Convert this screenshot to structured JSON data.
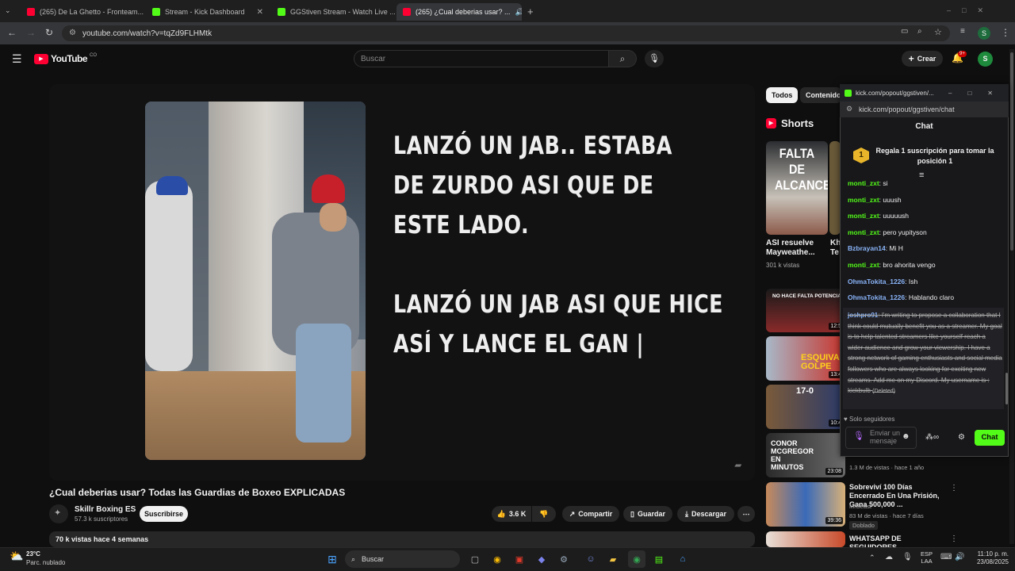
{
  "browser": {
    "tabs": [
      {
        "title": "(265) De La Ghetto - Fronteam...",
        "color": "#ff0033"
      },
      {
        "title": "Stream - Kick Dashboard",
        "color": "#53fc18"
      },
      {
        "title": "GGStiven Stream - Watch Live ...",
        "color": "#53fc18"
      },
      {
        "title": "(265) ¿Cual deberias usar? ...",
        "color": "#ff0033"
      }
    ],
    "url": "youtube.com/watch?v=tqZd9FLHMtk",
    "profile": "S"
  },
  "youtube": {
    "logo": "YouTube",
    "region": "CO",
    "search_placeholder": "Buscar",
    "create_label": "Crear",
    "notif_count": "9+",
    "avatar": "S"
  },
  "video": {
    "captions": [
      "LANZÓ UN JAB.. ESTABA",
      "DE ZURDO ASI QUE DE",
      "ESTE LADO.",
      "LANZÓ UN JAB ASI QUE HICE",
      "ASÍ Y LANCE EL GAN |"
    ],
    "title": "¿Cual deberias usar? Todas las Guardias de Boxeo EXPLICADAS",
    "channel": "Skillr Boxing ES",
    "subscribers": "57.3 k suscriptores",
    "subscribe_label": "Suscribirse",
    "likes": "3.6 K",
    "share_label": "Compartir",
    "save_label": "Guardar",
    "download_label": "Descargar",
    "description_stats": "70 k vistas  hace 4 semanas"
  },
  "sidebar": {
    "chips": [
      "Todos",
      "Contenido d"
    ],
    "shorts_heading": "Shorts",
    "shorts": [
      {
        "thumb_text": "FALTA DE ALCANCE",
        "title": "ASI resuelve Mayweathe...",
        "meta": "301 k vistas"
      },
      {
        "thumb_text": "",
        "title": "Kh Te",
        "meta": ""
      }
    ],
    "related": [
      {
        "thumb_text": "NO HACE FALTA POTENCIA",
        "dur": "12:5",
        "title": "",
        "channel": "",
        "meta": ""
      },
      {
        "thumb_text": "ESQUIVA GOLPE",
        "dur": "13:4",
        "title": "",
        "channel": "",
        "meta": ""
      },
      {
        "thumb_text": "17-0",
        "dur": "10:4",
        "title": "",
        "channel": "",
        "meta": ""
      },
      {
        "thumb_text": "CONOR MCGREGOR EN MINUTOS",
        "dur": "23:08",
        "title": "",
        "channel": "",
        "meta": "1.3 M de vistas · hace 1 año"
      },
      {
        "thumb_text": "",
        "dur": "39:36",
        "title": "Sobreviví 100 Días Encerrado En Una Prisión, Gana 500,000 ...",
        "channel": "MrBeast",
        "meta": "83 M de vistas · hace 7 días",
        "badge": "Doblado"
      },
      {
        "thumb_text": "",
        "dur": "",
        "title": "WHATSAPP DE SEGUIDORES",
        "channel": "",
        "meta": ""
      }
    ]
  },
  "kick_popup": {
    "window_title": "kick.com/popout/ggstiven/...",
    "url": "kick.com/popout/ggstiven/chat",
    "heading": "Chat",
    "gift_rank": "1",
    "gift_text": "Regala 1 suscripción para tomar la posición 1",
    "messages": [
      {
        "user": "monti_zxt",
        "text": "si",
        "color": "green"
      },
      {
        "user": "monti_zxt",
        "text": "uuush",
        "color": "green"
      },
      {
        "user": "monti_zxt",
        "text": "uuuuush",
        "color": "green"
      },
      {
        "user": "monti_zxt",
        "text": "pero yupityson",
        "color": "green"
      },
      {
        "user": "Bzbrayan14",
        "text": "Mi H",
        "color": "blue"
      },
      {
        "user": "monti_zxt",
        "text": "bro ahorita vengo",
        "color": "green"
      },
      {
        "user": "OhmaTokita_1226",
        "text": "Ish",
        "color": "blue"
      },
      {
        "user": "OhmaTokita_1226",
        "text": "Hablando claro",
        "color": "blue"
      }
    ],
    "deleted_user": "joshpro91",
    "deleted_text": "I'm writing to propose a collaboration that I think could mutually benefit you as a streamer. My goal is to help talented streamers like yourself reach a wider audience and grow your viewership. I have a strong network of gaming enthusiasts and social media followers who are always looking for exciting new streams. Add me on my Discord. My username is : kickbulb",
    "deleted_tag": "(Deleted)",
    "followers_only": "Solo seguidores",
    "input_placeholder": "Enviar un mensaje",
    "chat_button": "Chat"
  },
  "taskbar": {
    "weather_temp": "23°C",
    "weather_desc": "Parc. nublado",
    "search_label": "Buscar",
    "lang": "ESP",
    "lang2": "LAA",
    "time": "11:10 p. m.",
    "date": "23/08/2025"
  }
}
